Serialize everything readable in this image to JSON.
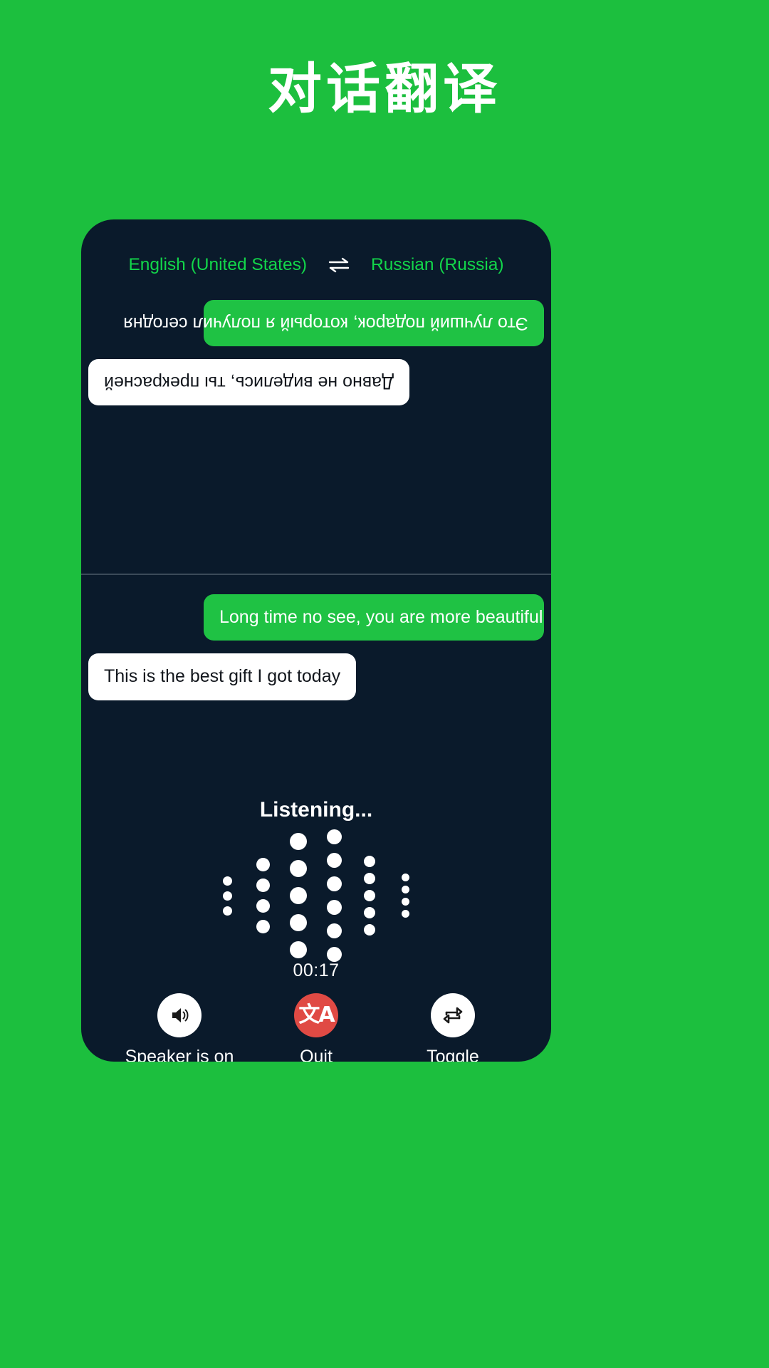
{
  "page": {
    "title": "对话翻译",
    "background_color": "#1cbf3e"
  },
  "device": {
    "background_color": "#0a1a2b",
    "accent_color": "#1fc244"
  },
  "language_bar": {
    "source_language": "English (United States)",
    "target_language": "Russian (Russia)",
    "swap_icon": "swap-horizontal-icon"
  },
  "conversation": {
    "top_pane_rotated": true,
    "top_messages": [
      {
        "text": "Это лучший подарок, который я получил сегодня",
        "style": "green",
        "align": "left"
      },
      {
        "text": "Давно не виделись, ты прекрасней",
        "style": "white",
        "align": "right"
      }
    ],
    "bottom_messages": [
      {
        "text": "Long time no see, you are more beautiful",
        "style": "green",
        "align": "right"
      },
      {
        "text": "This is the best gift I got today",
        "style": "white",
        "align": "left"
      }
    ]
  },
  "recording": {
    "status_text": "Listening...",
    "timer": "00:17",
    "waveform": {
      "columns": [
        {
          "dots": 3,
          "dot_size": 13
        },
        {
          "dots": 4,
          "dot_size": 19
        },
        {
          "dots": 5,
          "dot_size": 24
        },
        {
          "dots": 6,
          "dot_size": 21
        },
        {
          "dots": 5,
          "dot_size": 16
        },
        {
          "dots": 4,
          "dot_size": 11
        }
      ]
    }
  },
  "controls": [
    {
      "label": "Speaker is on",
      "icon": "speaker-on-icon",
      "circle_color": "#ffffff",
      "name": "speaker-button"
    },
    {
      "label": "Quit",
      "icon": "translate-icon",
      "circle_color": "#e04a44",
      "name": "quit-button"
    },
    {
      "label": "Toggle",
      "icon": "swap-repeat-icon",
      "circle_color": "#ffffff",
      "name": "toggle-button"
    }
  ]
}
